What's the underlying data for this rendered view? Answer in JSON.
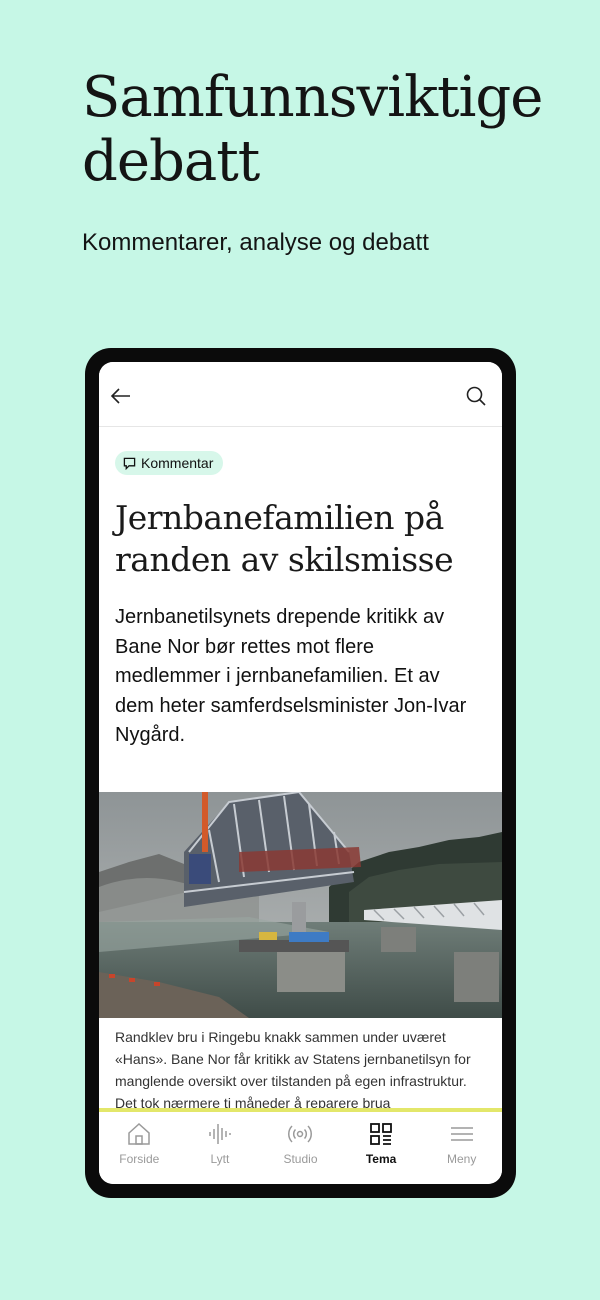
{
  "promo": {
    "title": "Samfunnsviktige debatt",
    "subtitle": "Kommentarer, analyse og debatt"
  },
  "article": {
    "badge": "Kommentar",
    "headline": "Jernbanefamilien på randen av skilsmisse",
    "lead": "Jernbanetilsynets drepende kritikk av Bane Nor bør rettes mot flere medlemmer i jernbanefamilien. Et av dem heter samferdselsminister Jon-Ivar Nygård.",
    "caption": "Randklev bru i Ringebu knakk sammen under uværet «Hans». Bane Nor får kritikk av Statens jernbanetilsyn for manglende oversikt over tilstanden på egen infrastruktur. Det tok nærmere ti måneder å reparere brua"
  },
  "nav": {
    "items": [
      {
        "label": "Forside",
        "icon": "home-icon"
      },
      {
        "label": "Lytt",
        "icon": "audio-wave-icon"
      },
      {
        "label": "Studio",
        "icon": "broadcast-icon"
      },
      {
        "label": "Tema",
        "icon": "grid-icon"
      },
      {
        "label": "Meny",
        "icon": "menu-icon"
      }
    ],
    "active": "Tema"
  },
  "colors": {
    "background": "#c6f7e6",
    "badge_bg": "#d7f7ea",
    "nav_border": "#e3e76a"
  }
}
